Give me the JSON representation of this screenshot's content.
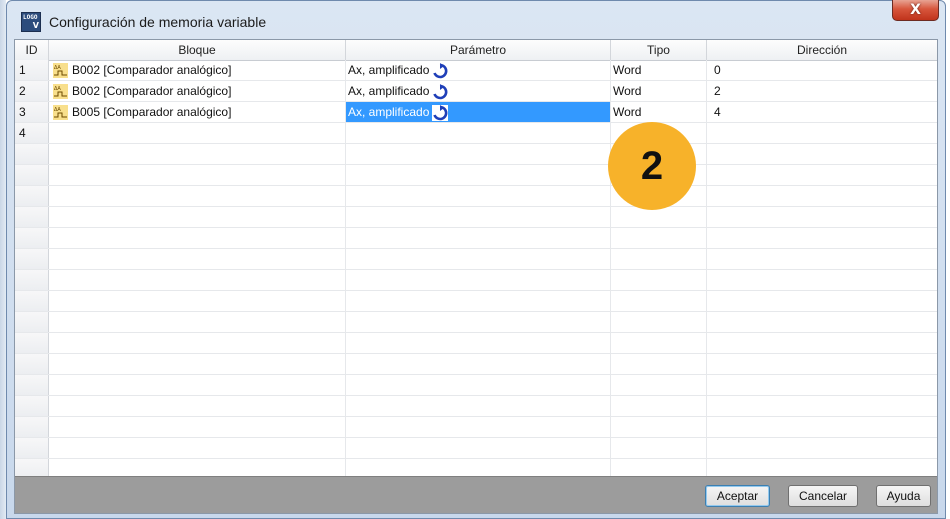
{
  "window": {
    "title": "Configuración de memoria variable",
    "app_icon_text_top": "LOGO",
    "app_icon_text_bottom": "V",
    "close_symbol": "X"
  },
  "table": {
    "columns": [
      "ID",
      "Bloque",
      "Parámetro",
      "Tipo",
      "Dirección"
    ],
    "rows": [
      {
        "id": "1",
        "bloque": "B002 [Comparador analógico]",
        "parametro": "Ax, amplificado",
        "tipo": "Word",
        "direccion": "0",
        "selected": false
      },
      {
        "id": "2",
        "bloque": "B002 [Comparador analógico]",
        "parametro": "Ax, amplificado",
        "tipo": "Word",
        "direccion": "2",
        "selected": false
      },
      {
        "id": "3",
        "bloque": "B005 [Comparador analógico]",
        "parametro": "Ax, amplificado",
        "tipo": "Word",
        "direccion": "4",
        "selected": true
      },
      {
        "id": "4",
        "bloque": "",
        "parametro": "",
        "tipo": "",
        "direccion": "",
        "selected": false
      }
    ],
    "selection_color": "#3399ff"
  },
  "icons": {
    "block_icon": "analog-comparator-icon",
    "param_icon": "cycle-arrows-icon"
  },
  "buttons": {
    "accept": "Aceptar",
    "cancel": "Cancelar",
    "help": "Ayuda"
  },
  "callout": {
    "label": "2",
    "color": "#f7b22a"
  }
}
